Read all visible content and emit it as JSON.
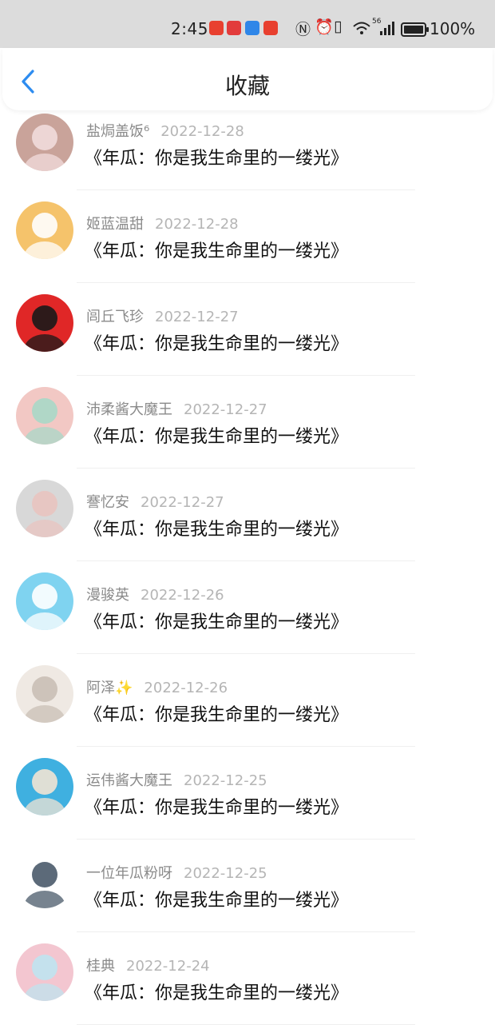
{
  "status_bar": {
    "time": "2:45",
    "battery": "100%",
    "network": "56",
    "app_icons": [
      {
        "name": "taobao-icon",
        "label": "淘",
        "color": "#e8402f"
      },
      {
        "name": "red-app-icon",
        "label": "",
        "color": "#e23b3b"
      },
      {
        "name": "cloud-app-icon",
        "label": "",
        "color": "#2f86e8"
      },
      {
        "name": "sale-app-icon",
        "label": "淘",
        "color": "#e8402f"
      }
    ]
  },
  "header": {
    "title": "收藏",
    "back_icon": "chevron-left-icon",
    "accent": "#2d8cf0"
  },
  "items": [
    {
      "user": "盐焗盖饭⁶",
      "date": "2022-12-28",
      "title": "《年瓜：你是我生命里的一缕光》",
      "avatar_colors": [
        "#c9a39a",
        "#f1dcdc"
      ]
    },
    {
      "user": "姬蓝温甜",
      "date": "2022-12-28",
      "title": "《年瓜：你是我生命里的一缕光》",
      "avatar_colors": [
        "#f5c36b",
        "#ffffff"
      ]
    },
    {
      "user": "闾丘飞珍",
      "date": "2022-12-27",
      "title": "《年瓜：你是我生命里的一缕光》",
      "avatar_colors": [
        "#e02727",
        "#1a1a1a"
      ]
    },
    {
      "user": "沛柔酱大魔王",
      "date": "2022-12-27",
      "title": "《年瓜：你是我生命里的一缕光》",
      "avatar_colors": [
        "#f2c8c4",
        "#a8d8c8"
      ]
    },
    {
      "user": "謇忆安",
      "date": "2022-12-27",
      "title": "《年瓜：你是我生命里的一缕光》",
      "avatar_colors": [
        "#d8d8d8",
        "#e9c4c0"
      ]
    },
    {
      "user": "漫骏英",
      "date": "2022-12-26",
      "title": "《年瓜：你是我生命里的一缕光》",
      "avatar_colors": [
        "#7fd3f0",
        "#ffffff"
      ]
    },
    {
      "user": "阿泽✨",
      "date": "2022-12-26",
      "title": "《年瓜：你是我生命里的一缕光》",
      "avatar_colors": [
        "#efe9e3",
        "#c9bfb5"
      ]
    },
    {
      "user": "运伟酱大魔王",
      "date": "2022-12-25",
      "title": "《年瓜：你是我生命里的一缕光》",
      "avatar_colors": [
        "#3fb0e0",
        "#f1e4d4"
      ]
    },
    {
      "user": "一位年瓜粉呀",
      "date": "2022-12-25",
      "title": "《年瓜：你是我生命里的一缕光》",
      "avatar_colors": [
        "#ffffff",
        "#4a5a6a"
      ]
    },
    {
      "user": "桂典",
      "date": "2022-12-24",
      "title": "《年瓜：你是我生命里的一缕光》",
      "avatar_colors": [
        "#f3c6d0",
        "#bfe3ef"
      ]
    }
  ]
}
